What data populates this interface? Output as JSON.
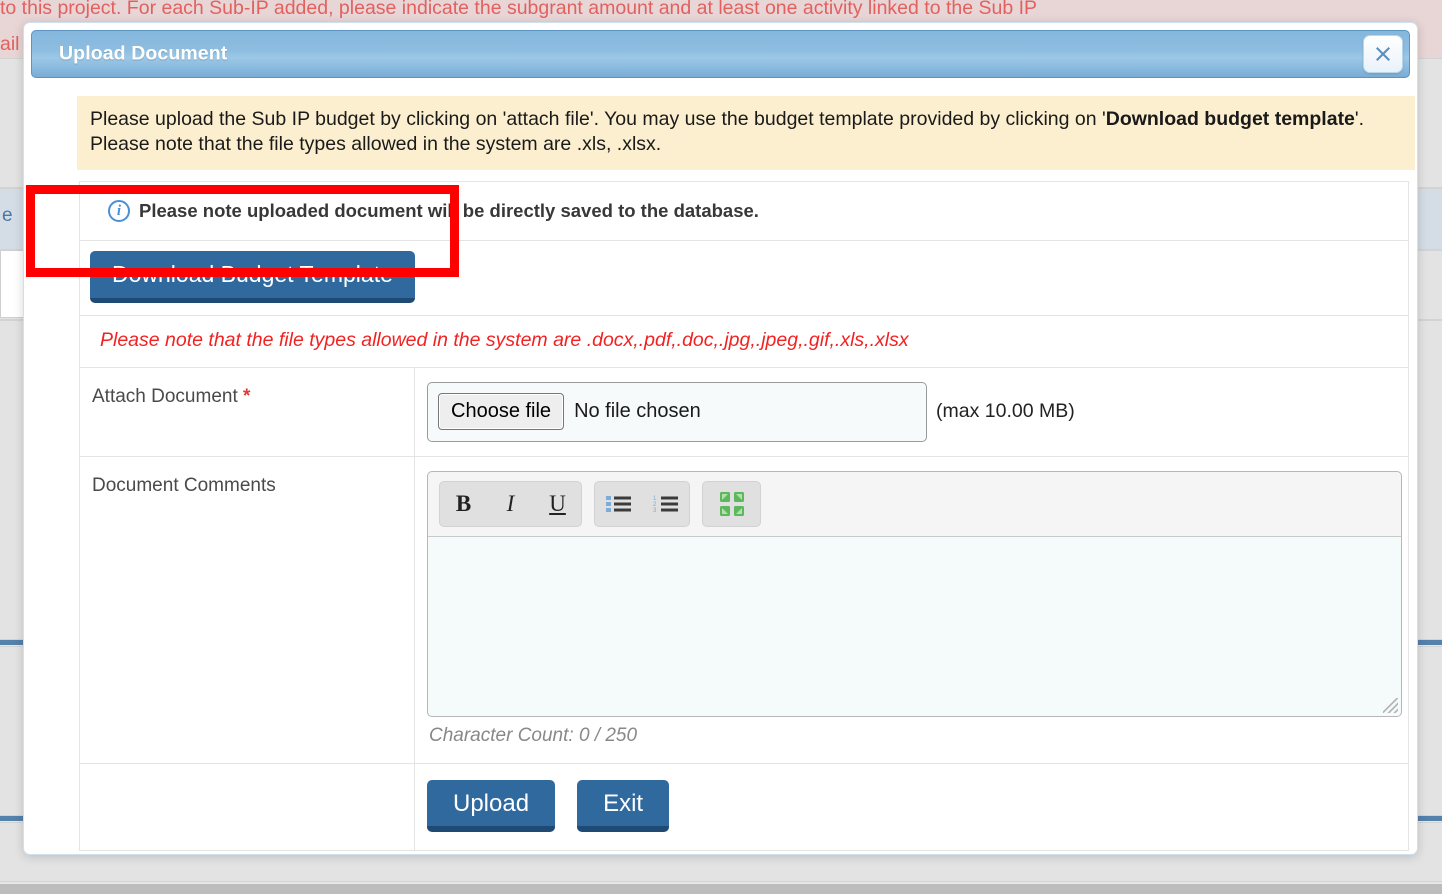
{
  "background": {
    "alert_line1": "to this project. For each Sub-IP added, please indicate the subgrant amount and at least one activity linked to the Sub IP",
    "alert_line2": "ail",
    "link_text": "e"
  },
  "modal": {
    "title": "Upload Document",
    "close_icon": "close-icon",
    "notice": {
      "part1": "Please upload the Sub IP budget by clicking on 'attach file'. You may use the budget template provided by clicking on '",
      "bold": "Download budget template",
      "part2": "'. Please note that the file types allowed in the system are .xls, .xlsx."
    },
    "info_note": {
      "icon": "info-circle-icon",
      "text": "Please note uploaded document will be directly saved to the database."
    },
    "download_button": "Download Budget Template",
    "filetypes_note": "Please note that the file types allowed in the system are .docx,.pdf,.doc,.jpg,.jpeg,.gif,.xls,.xlsx",
    "attach": {
      "label": "Attach Document",
      "required_marker": "*",
      "choose_button": "Choose file",
      "file_status": "No file chosen",
      "max_size": "(max 10.00 MB)"
    },
    "comments": {
      "label": "Document Comments",
      "toolbar": [
        {
          "name": "bold-icon",
          "glyph": "B"
        },
        {
          "name": "italic-icon",
          "glyph": "I"
        },
        {
          "name": "underline-icon",
          "glyph": "U"
        },
        {
          "name": "unordered-list-icon",
          "glyph": ""
        },
        {
          "name": "ordered-list-icon",
          "glyph": ""
        },
        {
          "name": "fullscreen-icon",
          "glyph": ""
        }
      ],
      "value": "",
      "character_count": "Character Count: 0 / 250"
    },
    "footer": {
      "upload_label": "Upload",
      "exit_label": "Exit"
    }
  },
  "colors": {
    "header_blue": "#8dbde0",
    "button_blue": "#30699e",
    "notice_yellow": "#fcefcf",
    "error_red": "#f22222",
    "highlight_red": "#ff0000",
    "info_blue": "#4a90d9"
  }
}
